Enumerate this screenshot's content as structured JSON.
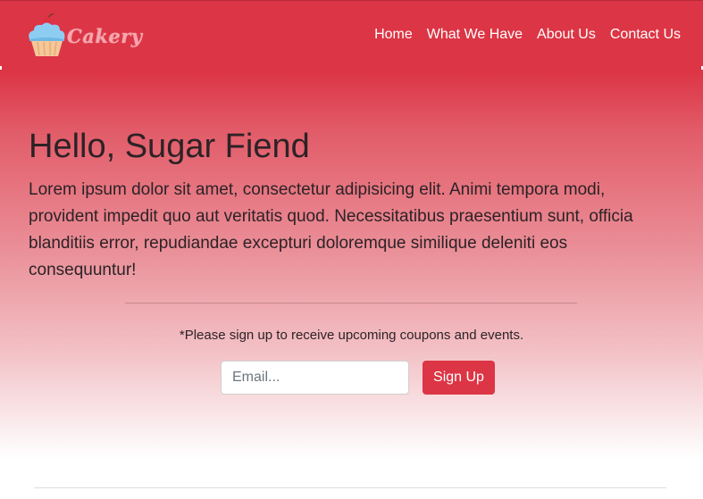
{
  "brand": {
    "name": "Cakery",
    "logo_icon": "cupcake-icon"
  },
  "nav": {
    "items": [
      {
        "label": "Home"
      },
      {
        "label": "What We Have"
      },
      {
        "label": "About Us"
      },
      {
        "label": "Contact Us"
      }
    ]
  },
  "hero": {
    "title": "Hello, Sugar Fiend",
    "text": "Lorem ipsum dolor sit amet, consectetur adipisicing elit. Animi tempora modi, provident impedit quo aut veritatis quod. Necessitatibus praesentium sunt, officia blanditiis error, repudiandae excepturi doloremque similique deleniti eos consequuntur!"
  },
  "signup": {
    "note": "*Please sign up to receive upcoming coupons and events.",
    "email_placeholder": "Email...",
    "email_value": "",
    "button_label": "Sign Up"
  },
  "colors": {
    "primary": "#dc3545",
    "brand_text": "#f6a6ae",
    "text_dark": "#2c2226"
  }
}
